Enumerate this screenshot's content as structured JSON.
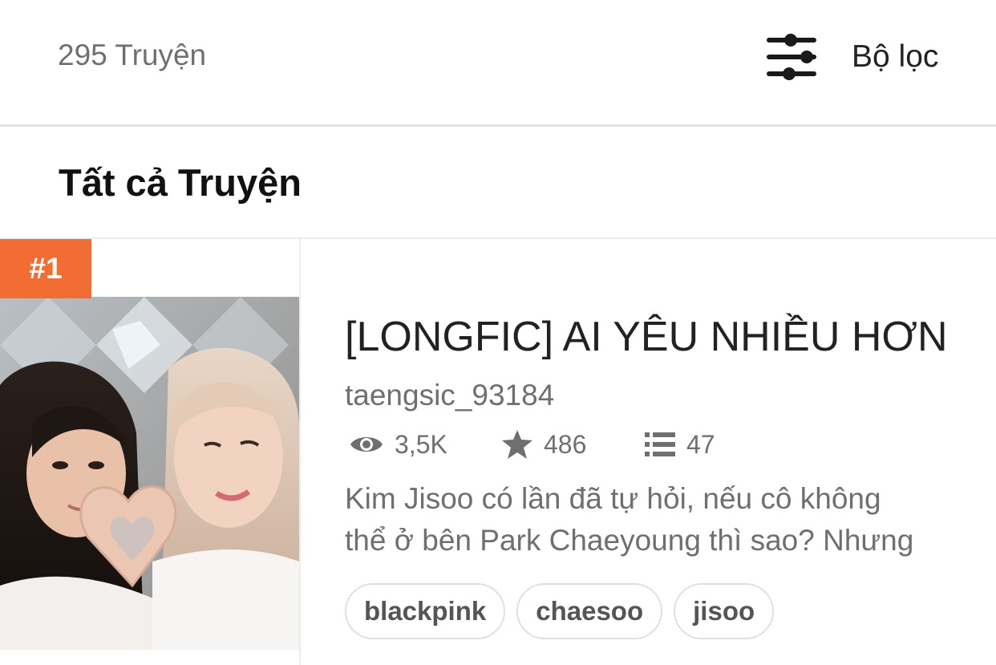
{
  "header": {
    "story_count": "295 Truyện",
    "filter_label": "Bộ lọc",
    "filter_icon": "sliders-icon"
  },
  "section": {
    "title": "Tất cả Truyện"
  },
  "stories": [
    {
      "rank": "#1",
      "title": "[LONGFIC] AI YÊU NHIỀU HƠN",
      "author": "taengsic_93184",
      "stats": {
        "views": "3,5K",
        "votes": "486",
        "parts": "47"
      },
      "description_lines": [
        "Kim Jisoo có lần đã tự hỏi, nếu cô không",
        "thể ở bên Park Chaeyoung thì sao? Nhưng"
      ],
      "tags": [
        "blackpink",
        "chaesoo",
        "jisoo"
      ]
    }
  ],
  "colors": {
    "rank_badge": "#f26d33",
    "muted_text": "#6f6f6f",
    "divider": "#e2e2e2"
  }
}
